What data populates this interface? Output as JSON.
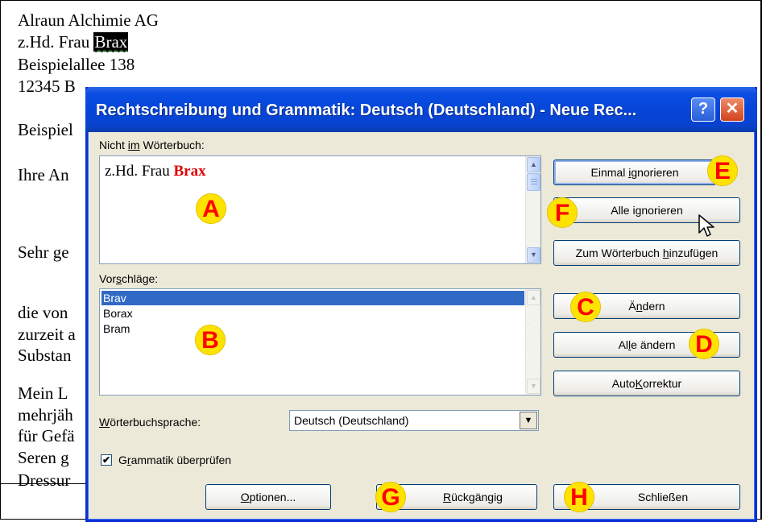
{
  "document": {
    "lines": [
      "Alraun Alchimie AG",
      "z.Hd. Frau ",
      "Brax",
      "Beispielallee 138",
      "12345 B",
      "Beispiel",
      "Ihre An",
      "Sehr ge",
      "die von",
      "zurzeit a",
      "Substan",
      "Mein L",
      "mehrjäh",
      "für Gefä",
      "Seren g",
      "Dressur"
    ]
  },
  "dialog": {
    "title": "Rechtschreibung und Grammatik: Deutsch (Deutschland) - Neue Rec...",
    "help_icon": "help-icon",
    "close_icon": "close-icon",
    "not_in_dictionary_label_pre": "Nicht ",
    "not_in_dictionary_label_ul": "im",
    "not_in_dictionary_label_post": " Wörterbuch:",
    "error_text_normal": "z.Hd. Frau ",
    "error_text_word": "Brax",
    "suggestions_label_pre": "Vor",
    "suggestions_label_ul": "s",
    "suggestions_label_post": "chläge:",
    "suggestions": [
      "Brav",
      "Borax",
      "Bram"
    ],
    "dictionary_language_label_pre": "",
    "dictionary_language_label_ul": "W",
    "dictionary_language_label_post": "örterbuchsprache:",
    "dictionary_language_value": "Deutsch (Deutschland)",
    "check_grammar_label_pre": "G",
    "check_grammar_label_ul": "r",
    "check_grammar_label_post": "ammatik überprüfen",
    "check_grammar_checked": true,
    "buttons": {
      "ignore_once": {
        "pre": "Einmal ",
        "ul": "i",
        "post": "gnorieren"
      },
      "ignore_all": {
        "pre": "Alle i",
        "ul": "g",
        "post": "norieren"
      },
      "add_to_dictionary": {
        "pre": "Zum Wörterbuch ",
        "ul": "h",
        "post": "inzufügen"
      },
      "change": {
        "pre": "Ä",
        "ul": "n",
        "post": "dern"
      },
      "change_all": {
        "pre": "Al",
        "ul": "l",
        "post": "e ändern"
      },
      "autocorrect": {
        "pre": "Auto",
        "ul": "K",
        "post": "orrektur"
      },
      "options": {
        "pre": "",
        "ul": "O",
        "post": "ptionen..."
      },
      "undo": {
        "pre": "",
        "ul": "R",
        "post": "ückgängig"
      },
      "close": {
        "pre": "Schließen",
        "ul": "",
        "post": ""
      }
    }
  },
  "annotations": [
    "A",
    "B",
    "C",
    "D",
    "E",
    "F",
    "G",
    "H"
  ],
  "colors": {
    "title_bar": "#0545d8",
    "dialog_bg": "#ece9d8",
    "selection": "#316ac5",
    "error_word": "#e00000",
    "badge_fill": "#ffe300",
    "badge_text": "#ff0000"
  }
}
